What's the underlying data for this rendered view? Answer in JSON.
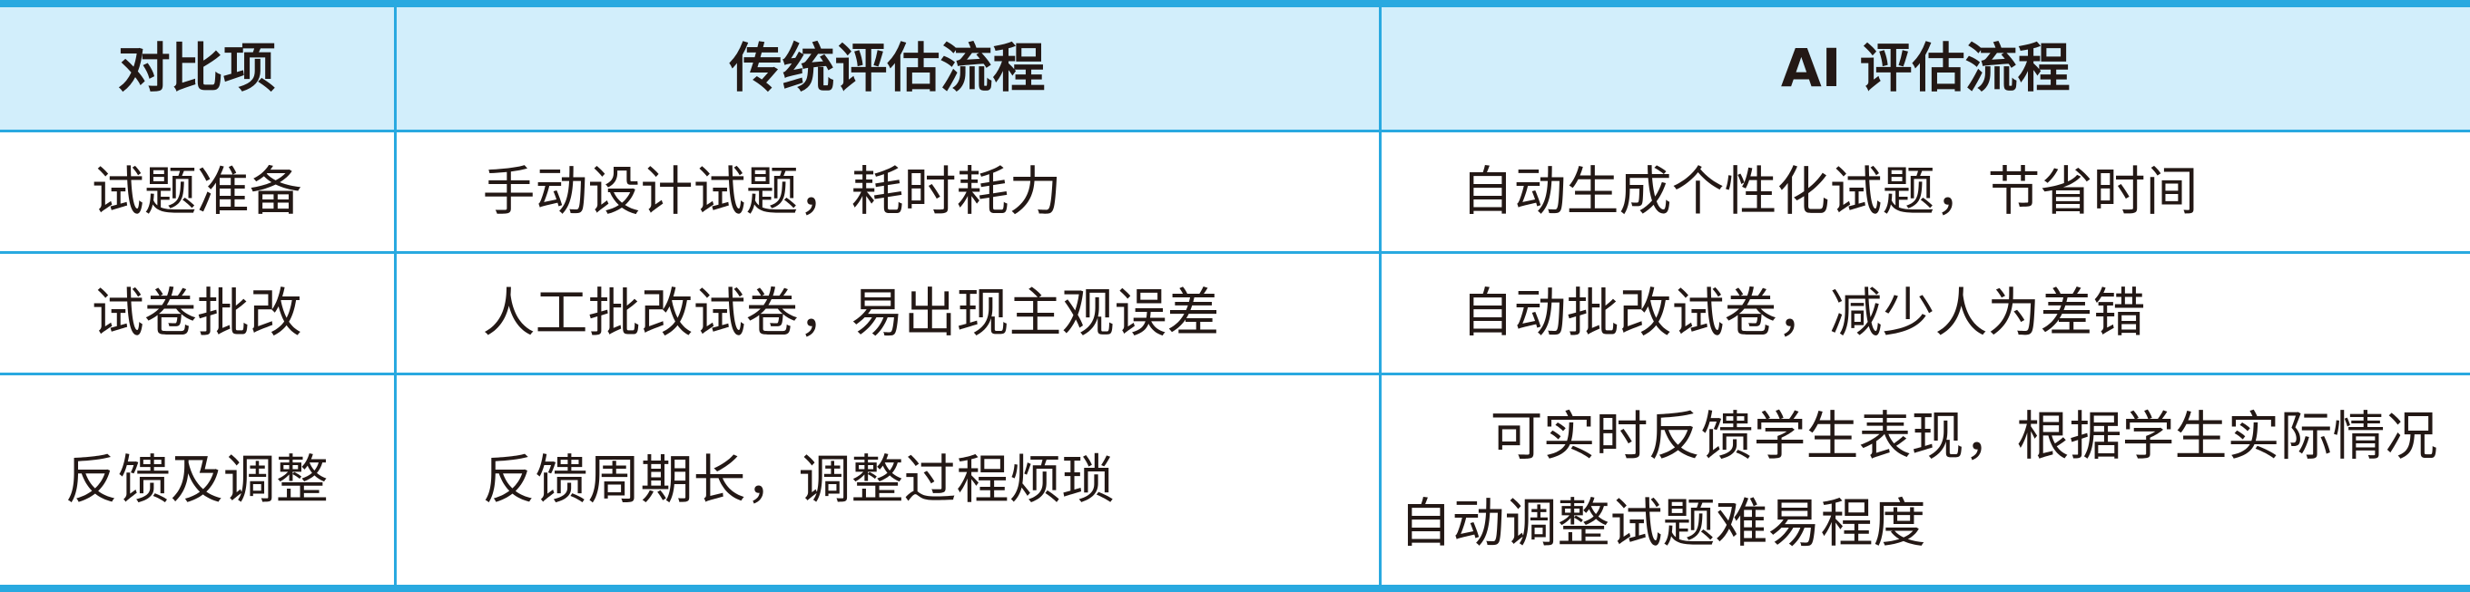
{
  "table": {
    "headers": [
      "对比项",
      "传统评估流程",
      "AI 评估流程"
    ],
    "rows": [
      {
        "item": "试题准备",
        "traditional": "手动设计试题，耗时耗力",
        "ai": "自动生成个性化试题，节省时间"
      },
      {
        "item": "试卷批改",
        "traditional": "人工批改试卷，易出现主观误差",
        "ai": "自动批改试卷，减少人为差错"
      },
      {
        "item": "反馈及调整",
        "traditional": "反馈周期长，调整过程烦琐",
        "ai": "可实时反馈学生表现，根据学生实际情况自动调整试题难易程度"
      }
    ]
  },
  "colors": {
    "border": "#29a9e0",
    "header_background": "#d2eefb",
    "text": "#231815"
  }
}
